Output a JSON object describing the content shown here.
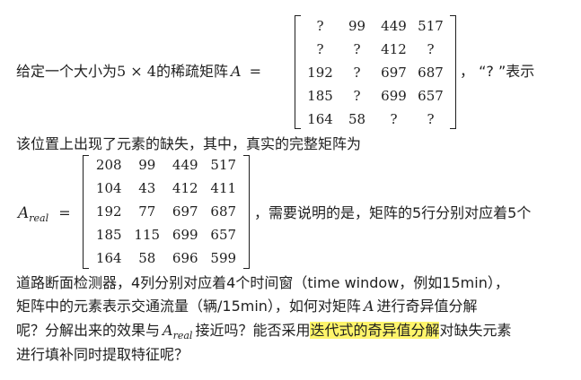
{
  "paragraph": {
    "intro_prefix": "给定一个大小为",
    "size_expr": "5 × 4",
    "intro_mid": "的稀疏矩阵",
    "A_symbol": "A",
    "equals": "=",
    "comma_quote": "，  “? ”表示",
    "line2": "该位置上出现了元素的缺失，其中，真实的完整矩阵为",
    "A_real_base": "A",
    "A_real_sub": "real",
    "after_real": "，需要说明的是，矩阵的5行分别对应着5个",
    "line4": "道路断面检测器，4列分别对应着4个时间窗（time window，例如15min），",
    "line5_a": "矩阵中的元素表示交通流量（辆/15min），如何对矩阵",
    "line5_A": "A",
    "line5_b": "进行奇异值分解",
    "line6_a": "呢？分解出来的效果与",
    "line6_sub": "real",
    "line6_b": "接近吗？能否采用",
    "line6_hl": "迭代式的奇异值分解",
    "line6_c": "对缺失元素",
    "line7": "进行填补同时提取特征呢？"
  },
  "sparse_matrix": [
    [
      "?",
      "99",
      "449",
      "517"
    ],
    [
      "?",
      "?",
      "412",
      "?"
    ],
    [
      "192",
      "?",
      "697",
      "687"
    ],
    [
      "185",
      "?",
      "699",
      "657"
    ],
    [
      "164",
      "58",
      "?",
      "?"
    ]
  ],
  "real_matrix": [
    [
      "208",
      "99",
      "449",
      "517"
    ],
    [
      "104",
      "43",
      "412",
      "411"
    ],
    [
      "192",
      "77",
      "697",
      "687"
    ],
    [
      "185",
      "115",
      "699",
      "657"
    ],
    [
      "164",
      "58",
      "696",
      "599"
    ]
  ],
  "colors": {
    "text": "#1f1f1f",
    "highlight": "#fff56b",
    "background": "#ffffff"
  }
}
